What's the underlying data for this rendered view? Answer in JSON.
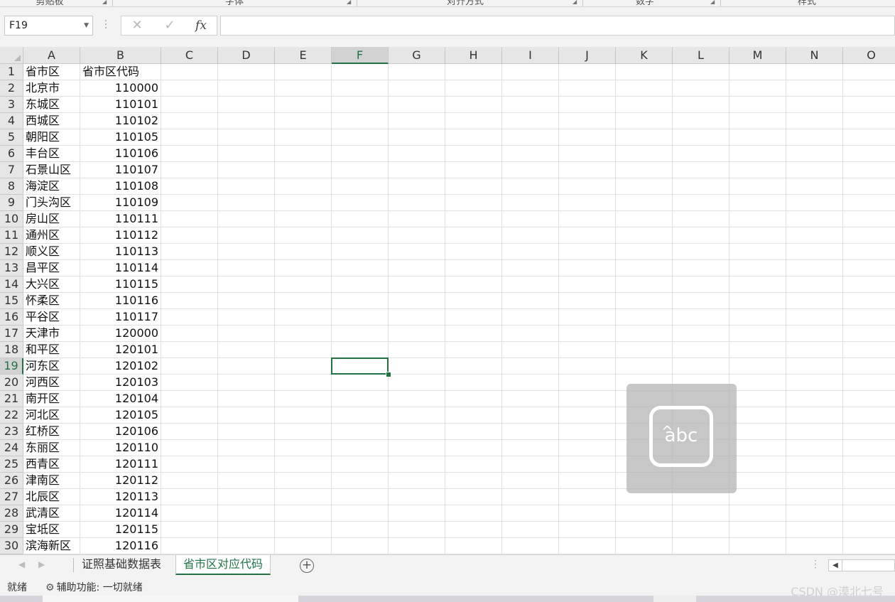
{
  "ribbon": {
    "groups": [
      "剪贴板",
      "字体",
      "对齐方式",
      "数字",
      "样式"
    ]
  },
  "formula_bar": {
    "name_box": "F19",
    "cancel_icon": "close-icon",
    "enter_icon": "check-icon",
    "fx_label": "fx",
    "formula": ""
  },
  "columns": [
    "A",
    "B",
    "C",
    "D",
    "E",
    "F",
    "G",
    "H",
    "I",
    "J",
    "K",
    "L",
    "M",
    "N",
    "O"
  ],
  "active_column": "F",
  "active_row": "19",
  "rows": [
    {
      "n": "1",
      "a": "省市区",
      "b": "省市区代码"
    },
    {
      "n": "2",
      "a": "北京市",
      "b": "110000"
    },
    {
      "n": "3",
      "a": "东城区",
      "b": "110101"
    },
    {
      "n": "4",
      "a": "西城区",
      "b": "110102"
    },
    {
      "n": "5",
      "a": "朝阳区",
      "b": "110105"
    },
    {
      "n": "6",
      "a": "丰台区",
      "b": "110106"
    },
    {
      "n": "7",
      "a": "石景山区",
      "b": "110107"
    },
    {
      "n": "8",
      "a": "海淀区",
      "b": "110108"
    },
    {
      "n": "9",
      "a": "门头沟区",
      "b": "110109"
    },
    {
      "n": "10",
      "a": "房山区",
      "b": "110111"
    },
    {
      "n": "11",
      "a": "通州区",
      "b": "110112"
    },
    {
      "n": "12",
      "a": "顺义区",
      "b": "110113"
    },
    {
      "n": "13",
      "a": "昌平区",
      "b": "110114"
    },
    {
      "n": "14",
      "a": "大兴区",
      "b": "110115"
    },
    {
      "n": "15",
      "a": "怀柔区",
      "b": "110116"
    },
    {
      "n": "16",
      "a": "平谷区",
      "b": "110117"
    },
    {
      "n": "17",
      "a": "天津市",
      "b": "120000"
    },
    {
      "n": "18",
      "a": "和平区",
      "b": "120101"
    },
    {
      "n": "19",
      "a": "河东区",
      "b": "120102"
    },
    {
      "n": "20",
      "a": "河西区",
      "b": "120103"
    },
    {
      "n": "21",
      "a": "南开区",
      "b": "120104"
    },
    {
      "n": "22",
      "a": "河北区",
      "b": "120105"
    },
    {
      "n": "23",
      "a": "红桥区",
      "b": "120106"
    },
    {
      "n": "24",
      "a": "东丽区",
      "b": "120110"
    },
    {
      "n": "25",
      "a": "西青区",
      "b": "120111"
    },
    {
      "n": "26",
      "a": "津南区",
      "b": "120112"
    },
    {
      "n": "27",
      "a": "北辰区",
      "b": "120113"
    },
    {
      "n": "28",
      "a": "武清区",
      "b": "120114"
    },
    {
      "n": "29",
      "a": "宝坻区",
      "b": "120115"
    },
    {
      "n": "30",
      "a": "滨海新区",
      "b": "120116"
    }
  ],
  "ime_widget": {
    "label": "abc",
    "caret": "^"
  },
  "sheet_tabs": {
    "tabs": [
      "证照基础数据表",
      "省市区对应代码"
    ],
    "active_index": 1,
    "add_label": "+"
  },
  "status_bar": {
    "ready": "就绪",
    "accessibility": "辅助功能: 一切就绪",
    "watermark": "CSDN @漠北七号"
  }
}
